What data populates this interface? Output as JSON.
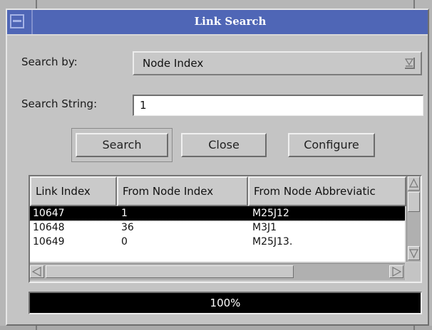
{
  "window": {
    "title": "Link Search"
  },
  "search_by": {
    "label": "Search by:",
    "value": "Node Index"
  },
  "search_string": {
    "label": "Search String:",
    "value": "1"
  },
  "buttons": {
    "search": "Search",
    "close": "Close",
    "configure": "Configure"
  },
  "table": {
    "columns": [
      "Link Index",
      "From Node Index",
      "From Node Abbreviatic"
    ],
    "rows": [
      {
        "link_index": "10647",
        "from_node_index": "1",
        "from_node_abbreviation": "M25J12",
        "selected": true
      },
      {
        "link_index": "10648",
        "from_node_index": "36",
        "from_node_abbreviation": "M3J1",
        "selected": false
      },
      {
        "link_index": "10649",
        "from_node_index": "0",
        "from_node_abbreviation": "M25J13.",
        "selected": false
      }
    ]
  },
  "progress": {
    "fraction": 1.0,
    "text": "100%"
  },
  "colors": {
    "titlebar": "#4f66b6",
    "selection": "#000000",
    "progress_fill": "#000000"
  },
  "icons": [
    "window-menu-icon",
    "combo-arrow-icon",
    "scroll-up-icon",
    "scroll-down-icon",
    "scroll-left-icon",
    "scroll-right-icon"
  ]
}
